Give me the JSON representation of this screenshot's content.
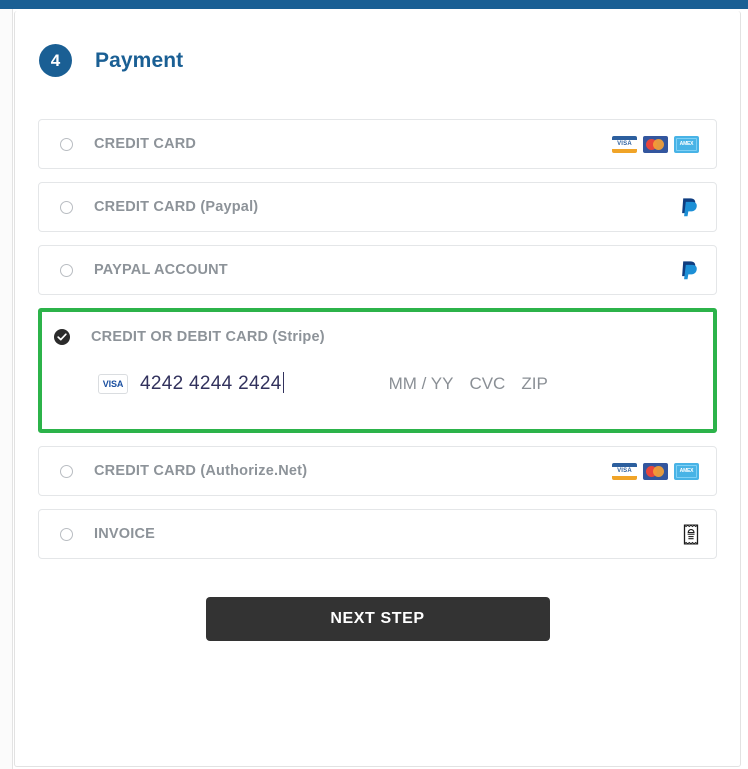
{
  "theme": {
    "accent_blue": "#1a5f94",
    "selected_green": "#2cb34a",
    "button_dark": "#333333",
    "label_gray": "#8d9399"
  },
  "step": {
    "number": "4",
    "title": "Payment"
  },
  "options": [
    {
      "id": "credit-card",
      "label": "CREDIT CARD",
      "selected": false,
      "icons": [
        "visa-card-icon",
        "mastercard-card-icon",
        "amex-card-icon"
      ]
    },
    {
      "id": "credit-card-paypal",
      "label": "CREDIT CARD (Paypal)",
      "selected": false,
      "icons": [
        "paypal-icon"
      ]
    },
    {
      "id": "paypal-account",
      "label": "PAYPAL ACCOUNT",
      "selected": false,
      "icons": [
        "paypal-icon"
      ]
    },
    {
      "id": "stripe",
      "label": "CREDIT OR DEBIT CARD (Stripe)",
      "selected": true,
      "icons": []
    },
    {
      "id": "credit-card-authorize",
      "label": "CREDIT CARD (Authorize.Net)",
      "selected": false,
      "icons": [
        "visa-card-icon",
        "mastercard-card-icon",
        "amex-card-icon"
      ]
    },
    {
      "id": "invoice",
      "label": "INVOICE",
      "selected": false,
      "icons": [
        "invoice-icon"
      ]
    }
  ],
  "stripe_form": {
    "brand_badge": "VISA",
    "card_number_value": "4242 4244 2424",
    "expiry_placeholder": "MM / YY",
    "cvc_placeholder": "CVC",
    "zip_placeholder": "ZIP"
  },
  "card_brands": {
    "visa_word": "VISA",
    "amex_word": "AMEX"
  },
  "actions": {
    "next_step_label": "NEXT STEP"
  }
}
